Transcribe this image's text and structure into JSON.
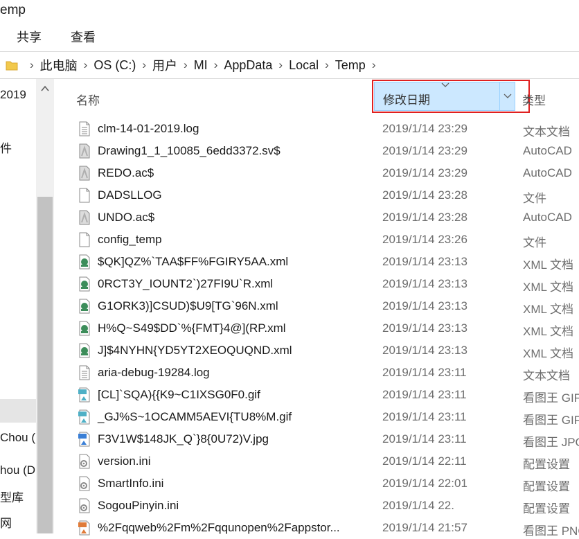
{
  "window": {
    "title": "emp"
  },
  "ribbon": {
    "tabs": [
      "共享",
      "查看"
    ]
  },
  "address": {
    "crumbs": [
      "此电脑",
      "OS (C:)",
      "用户",
      "MI",
      "AppData",
      "Local",
      "Temp"
    ]
  },
  "nav": {
    "items": [
      "2019",
      "件",
      "Chou (",
      "hou (D",
      "型库",
      "网"
    ]
  },
  "columns": {
    "name": "名称",
    "date": "修改日期",
    "type": "类型"
  },
  "colors": {
    "selected_header": "#cce8ff",
    "highlight_box": "#e02020"
  },
  "files": [
    {
      "name": "clm-14-01-2019.log",
      "date": "2019/1/14 23:29",
      "type": "文本文档",
      "icon": "text-file-icon"
    },
    {
      "name": "Drawing1_1_10085_6edd3372.sv$",
      "date": "2019/1/14 23:29",
      "type": "AutoCAD",
      "icon": "autocad-file-icon"
    },
    {
      "name": "REDO.ac$",
      "date": "2019/1/14 23:29",
      "type": "AutoCAD",
      "icon": "autocad-file-icon"
    },
    {
      "name": "DADSLLOG",
      "date": "2019/1/14 23:28",
      "type": "文件",
      "icon": "blank-file-icon"
    },
    {
      "name": "UNDO.ac$",
      "date": "2019/1/14 23:28",
      "type": "AutoCAD",
      "icon": "autocad-file-icon"
    },
    {
      "name": "config_temp",
      "date": "2019/1/14 23:26",
      "type": "文件",
      "icon": "blank-file-icon"
    },
    {
      "name": "$QK]QZ%`TAA$FF%FGIRY5AA.xml",
      "date": "2019/1/14 23:13",
      "type": "XML 文档",
      "icon": "xml-file-icon"
    },
    {
      "name": "0RCT3Y_IOUNT2`)27FI9U`R.xml",
      "date": "2019/1/14 23:13",
      "type": "XML 文档",
      "icon": "xml-file-icon"
    },
    {
      "name": "G1ORK3)]CSUD)$U9[TG`96N.xml",
      "date": "2019/1/14 23:13",
      "type": "XML 文档",
      "icon": "xml-file-icon"
    },
    {
      "name": "H%Q~S49$DD`%{FMT}4@](RP.xml",
      "date": "2019/1/14 23:13",
      "type": "XML 文档",
      "icon": "xml-file-icon"
    },
    {
      "name": "J]$4NYHN{YD5YT2XEOQUQND.xml",
      "date": "2019/1/14 23:13",
      "type": "XML 文档",
      "icon": "xml-file-icon"
    },
    {
      "name": "aria-debug-19284.log",
      "date": "2019/1/14 23:11",
      "type": "文本文档",
      "icon": "text-file-icon"
    },
    {
      "name": "[CL]`SQA){{K9~C1IXSG0F0.gif",
      "date": "2019/1/14 23:11",
      "type": "看图王 GIF",
      "icon": "gif-file-icon"
    },
    {
      "name": "_GJ%S~1OCAMM5AEVI{TU8%M.gif",
      "date": "2019/1/14 23:11",
      "type": "看图王 GIF",
      "icon": "gif-file-icon"
    },
    {
      "name": "F3V1W$148JK_Q`}8{0U72)V.jpg",
      "date": "2019/1/14 23:11",
      "type": "看图王 JPG",
      "icon": "jpg-file-icon"
    },
    {
      "name": "version.ini",
      "date": "2019/1/14 22:11",
      "type": "配置设置",
      "icon": "ini-file-icon"
    },
    {
      "name": "SmartInfo.ini",
      "date": "2019/1/14 22:01",
      "type": "配置设置",
      "icon": "ini-file-icon"
    },
    {
      "name": "SogouPinyin.ini",
      "date": "2019/1/14 22.",
      "type": "配置设置",
      "icon": "ini-file-icon"
    },
    {
      "name": "%2Fqqweb%2Fm%2Fqqunopen%2Fappstor...",
      "date": "2019/1/14 21:57",
      "type": "看图王 PNG",
      "icon": "png-file-icon"
    }
  ]
}
